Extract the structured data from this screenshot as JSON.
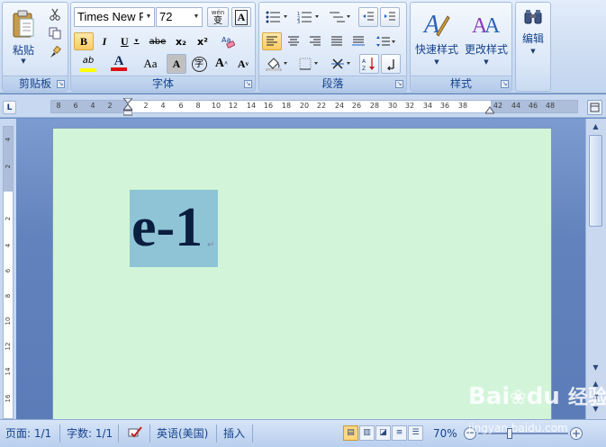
{
  "ribbon": {
    "clipboard": {
      "label": "剪贴板",
      "paste_label": "粘贴"
    },
    "font": {
      "label": "字体",
      "font_name": "Times New F",
      "font_size": "72",
      "wen_label": "wén",
      "wen_char": "变",
      "bold": "B",
      "italic": "I",
      "underline": "U",
      "strike": "abe",
      "sub": "x₂",
      "sup": "x²",
      "highlight": "ab",
      "color_a": "A",
      "aa": "Aa",
      "charborder": "A",
      "phonetic": "字",
      "grow": "A",
      "shrink": "A"
    },
    "paragraph": {
      "label": "段落"
    },
    "styles": {
      "label": "样式",
      "quick_styles": "快速样式",
      "change_styles": "更改样式"
    },
    "editing": {
      "label": "编辑"
    }
  },
  "ruler": {
    "ticks": [
      "8",
      "6",
      "4",
      "2",
      "2",
      "4",
      "6",
      "8",
      "10",
      "12",
      "14",
      "16",
      "18",
      "20",
      "22",
      "24",
      "26",
      "28",
      "30",
      "32",
      "34",
      "36",
      "38",
      "42",
      "44",
      "46",
      "48"
    ],
    "vticks": [
      "4",
      "2",
      "2",
      "4",
      "6",
      "8",
      "10",
      "12",
      "14",
      "16"
    ]
  },
  "document": {
    "text": "e-1",
    "para_mark": "↵"
  },
  "status": {
    "page": "页面: 1/1",
    "words": "字数: 1/1",
    "language": "英语(美国)",
    "insert": "插入",
    "zoom": "70%"
  },
  "watermark": {
    "brand": "Bai",
    "brand2": "du",
    "brand3": "经验",
    "url": "jingyan.baidu.com"
  },
  "colors": {
    "accent": "#15428b",
    "page": "#d2f5d9",
    "selection": "#8ec4d6",
    "font_color_bar": "#e01010",
    "highlight_bar": "#ffff00"
  }
}
